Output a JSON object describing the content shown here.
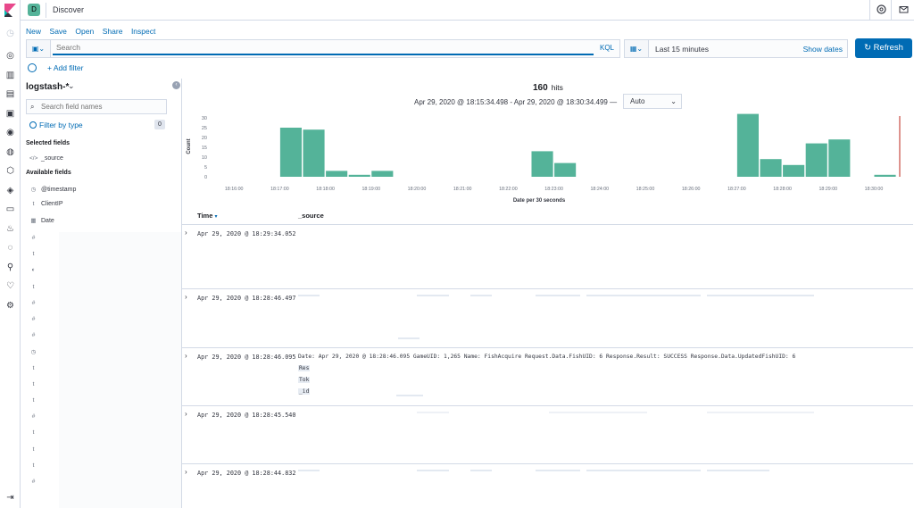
{
  "header": {
    "space_initial": "D",
    "app_title": "Discover",
    "help_icon": "help-icon",
    "mail_icon": "mail-icon"
  },
  "nav_icons": [
    "clock-icon",
    "discover-icon",
    "visualize-icon",
    "dashboard-icon",
    "canvas-icon",
    "maps-icon",
    "ml-icon",
    "graph-icon",
    "siem-icon",
    "logs-icon",
    "apm-icon",
    "uptime-icon",
    "dev-tools-icon",
    "stack-monitoring-icon",
    "management-icon"
  ],
  "top_menu": {
    "new": "New",
    "save": "Save",
    "open": "Open",
    "share": "Share",
    "inspect": "Inspect"
  },
  "query": {
    "placeholder": "Search",
    "language": "KQL"
  },
  "time": {
    "range_label": "Last 15 minutes",
    "show_dates": "Show dates",
    "refresh": "Refresh"
  },
  "filter": {
    "add_filter": "+ Add filter"
  },
  "sidebar": {
    "index_pattern": "logstash-*",
    "search_placeholder": "Search field names",
    "filter_by_type": "Filter by type",
    "filter_count": "0",
    "selected_title": "Selected fields",
    "selected_fields": [
      {
        "type": "</>",
        "name": "_source"
      }
    ],
    "available_title": "Available fields",
    "available_fields": [
      {
        "type": "◷",
        "name": "@timestamp"
      },
      {
        "type": "t",
        "name": "ClientIP"
      },
      {
        "type": "▦",
        "name": "Date"
      }
    ],
    "more_types": [
      "#",
      "t",
      "◐",
      "t",
      "#",
      "#",
      "#",
      "◷",
      "t",
      "t",
      "t",
      "#",
      "t",
      "t",
      "t",
      "#"
    ]
  },
  "results": {
    "hits_count": "160",
    "hits_label": "hits",
    "range_text": "Apr 29, 2020 @ 18:15:34.498 - Apr 29, 2020 @ 18:30:34.499 —",
    "interval": "Auto",
    "time_col": "Time",
    "source_col": "_source",
    "rows": [
      {
        "time": "Apr 29, 2020 @ 18:29:34.052"
      },
      {
        "time": "Apr 29, 2020 @ 18:28:46.497"
      },
      {
        "time": "Apr 29, 2020 @ 18:28:46.095",
        "source_line": "Date: Apr 29, 2020 @ 18:28:46.095 GameUID: 1,265 Name: FishAcquire Request.Data.FishUID: 6 Response.Result: SUCCESS Response.Data.UpdatedFishUID: 6",
        "extra_keys": [
          "Res",
          "Tok",
          "_id"
        ]
      },
      {
        "time": "Apr 29, 2020 @ 18:28:45.540"
      },
      {
        "time": "Apr 29, 2020 @ 18:28:44.832"
      }
    ]
  },
  "chart_data": {
    "type": "bar",
    "title": "",
    "xlabel": "Date per 30 seconds",
    "ylabel": "Count",
    "ylim": [
      0,
      30
    ],
    "yticks": [
      0,
      5,
      10,
      15,
      20,
      25,
      30
    ],
    "xtick_labels": [
      "18:16:00",
      "18:17:00",
      "18:18:00",
      "18:19:00",
      "18:20:00",
      "18:21:00",
      "18:22:00",
      "18:23:00",
      "18:24:00",
      "18:25:00",
      "18:26:00",
      "18:27:00",
      "18:28:00",
      "18:29:00",
      "18:30:00"
    ],
    "bars": [
      {
        "x": "18:17:00",
        "value": 25
      },
      {
        "x": "18:17:30",
        "value": 24
      },
      {
        "x": "18:18:00",
        "value": 3
      },
      {
        "x": "18:18:30",
        "value": 1
      },
      {
        "x": "18:19:00",
        "value": 3
      },
      {
        "x": "18:22:30",
        "value": 13
      },
      {
        "x": "18:23:00",
        "value": 7
      },
      {
        "x": "18:27:00",
        "value": 32
      },
      {
        "x": "18:27:30",
        "value": 9
      },
      {
        "x": "18:28:00",
        "value": 6
      },
      {
        "x": "18:28:30",
        "value": 17
      },
      {
        "x": "18:29:00",
        "value": 19
      },
      {
        "x": "18:30:00",
        "value": 1
      }
    ],
    "bar_color": "#54b399",
    "now_marker": "18:30:34",
    "now_color": "#bd271e"
  }
}
